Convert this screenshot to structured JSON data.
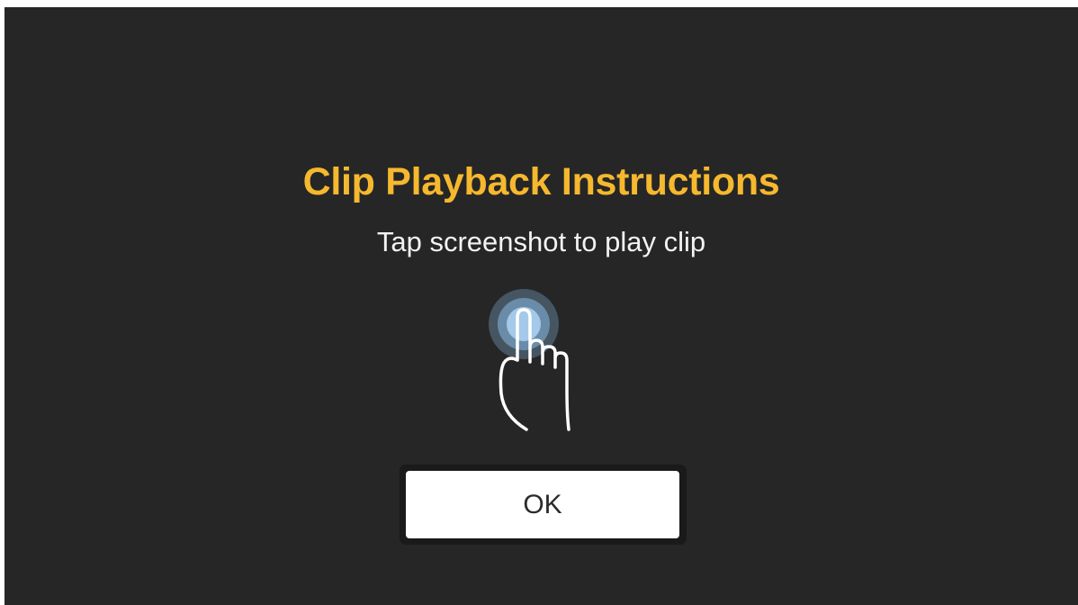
{
  "dialog": {
    "title": "Clip Playback Instructions",
    "subtitle": "Tap screenshot to play clip",
    "tap_icon": "hand-tap-icon",
    "ok_label": "OK"
  },
  "colors": {
    "background": "#262626",
    "title": "#f5b82e",
    "text": "#f2f2f2",
    "button_bg": "#ffffff",
    "button_text": "#2b2b2b",
    "tap_glow": "#8fc3ef"
  }
}
